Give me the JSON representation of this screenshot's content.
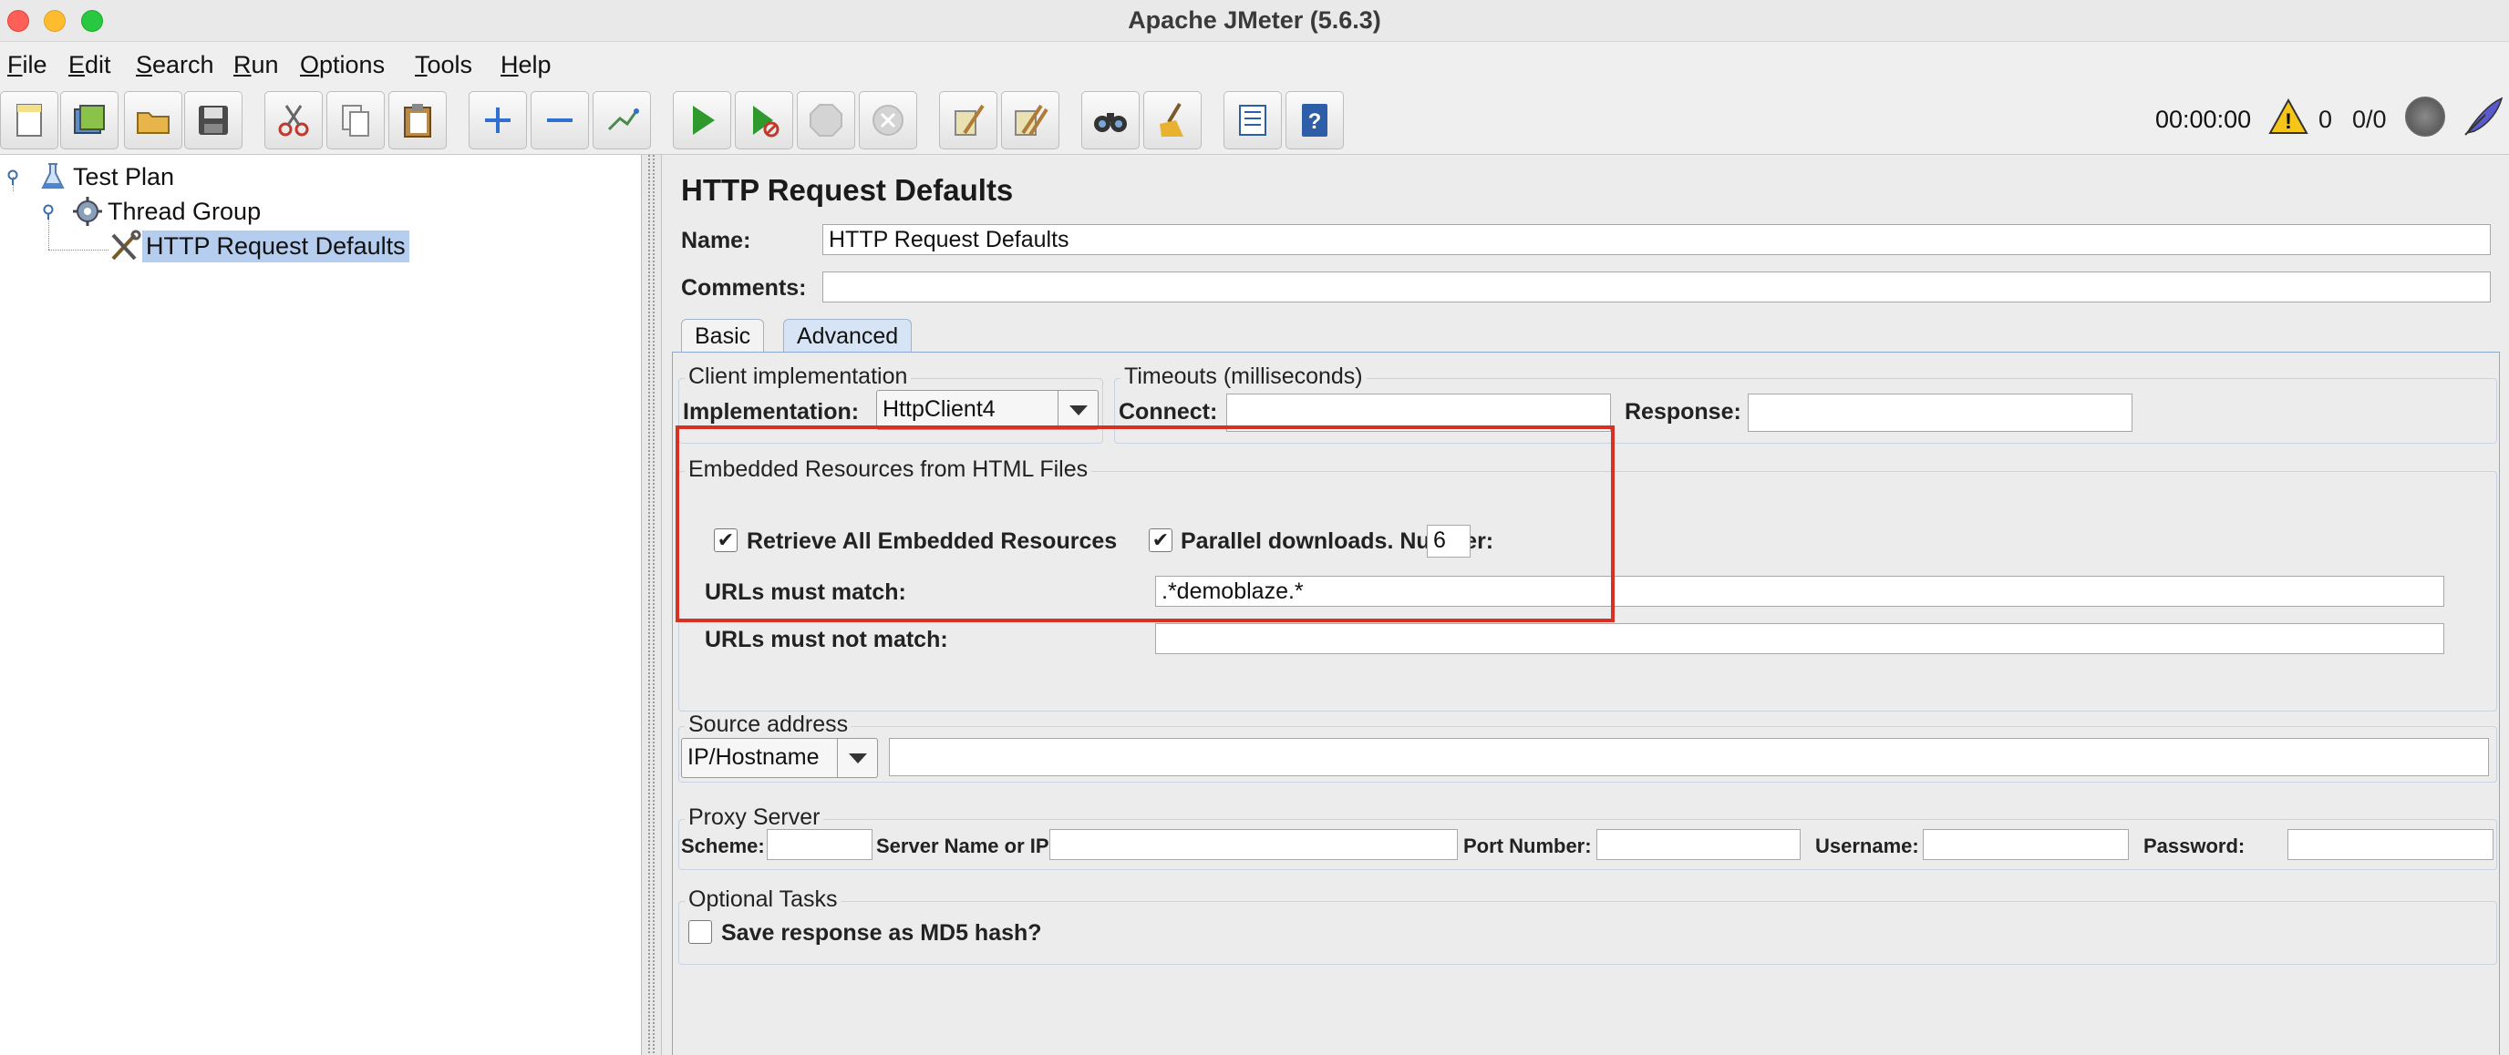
{
  "window": {
    "title": "Apache JMeter (5.6.3)"
  },
  "menu": [
    "File",
    "Edit",
    "Search",
    "Run",
    "Options",
    "Tools",
    "Help"
  ],
  "toolbar": {
    "buttons": [
      "new-icon",
      "templates-icon",
      "open-icon",
      "save-icon",
      "cut-icon",
      "copy-icon",
      "paste-icon",
      "expand-icon",
      "collapse-icon",
      "toggle-icon",
      "start-icon",
      "start-no-pauses-icon",
      "stop-icon",
      "shutdown-icon",
      "clear-icon",
      "clear-all-icon",
      "search-icon",
      "reset-search-icon",
      "function-helper-icon",
      "help-icon"
    ],
    "timer": "00:00:00",
    "warnings": "0",
    "threads": "0/0"
  },
  "tree": {
    "items": [
      {
        "label": "Test Plan"
      },
      {
        "label": "Thread Group"
      },
      {
        "label": "HTTP Request Defaults"
      }
    ]
  },
  "panel": {
    "title": "HTTP Request Defaults",
    "name_label": "Name:",
    "name_value": "HTTP Request Defaults",
    "comments_label": "Comments:",
    "comments_value": "",
    "tabs": [
      "Basic",
      "Advanced"
    ],
    "active_tab": "Advanced"
  },
  "client": {
    "group_title": "Client implementation",
    "impl_label": "Implementation:",
    "impl_value": "HttpClient4"
  },
  "timeouts": {
    "group_title": "Timeouts (milliseconds)",
    "connect_label": "Connect:",
    "connect_value": "",
    "response_label": "Response:",
    "response_value": ""
  },
  "embedded": {
    "group_title": "Embedded Resources from HTML Files",
    "retrieve_label": "Retrieve All Embedded Resources",
    "retrieve_checked": true,
    "parallel_label": "Parallel downloads. Number:",
    "parallel_checked": true,
    "parallel_value": "6",
    "match_label": "URLs must match:",
    "match_value": ".*demoblaze.*",
    "notmatch_label": "URLs must not match:",
    "notmatch_value": ""
  },
  "source": {
    "group_title": "Source address",
    "type_value": "IP/Hostname",
    "address_value": ""
  },
  "proxy": {
    "group_title": "Proxy Server",
    "scheme_label": "Scheme:",
    "server_label": "Server Name or IP:",
    "port_label": "Port Number:",
    "username_label": "Username:",
    "password_label": "Password:"
  },
  "optional": {
    "group_title": "Optional Tasks",
    "md5_label": "Save response as MD5 hash?",
    "md5_checked": false
  },
  "colors": {
    "highlight": "#d93025",
    "selection": "#b5cdee",
    "tab_active": "#d7e4f5"
  }
}
